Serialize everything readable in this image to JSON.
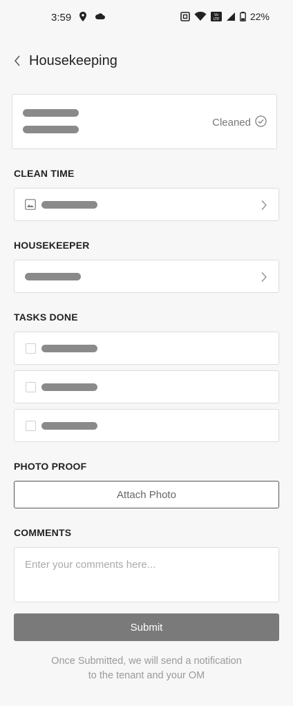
{
  "status_bar": {
    "time": "3:59",
    "battery": "22%",
    "volte": "Vo LTE"
  },
  "header": {
    "title": "Housekeeping"
  },
  "summary_card": {
    "status": "Cleaned"
  },
  "sections": {
    "clean_time": "CLEAN TIME",
    "housekeeper": "HOUSEKEEPER",
    "tasks_done": "TASKS DONE",
    "photo_proof": "PHOTO PROOF",
    "comments": "COMMENTS"
  },
  "actions": {
    "attach_photo": "Attach Photo",
    "submit": "Submit"
  },
  "comments": {
    "placeholder": "Enter your comments here..."
  },
  "footnote": {
    "line1": "Once Submitted, we will send a notification",
    "line2": "to the tenant and your OM"
  },
  "tasks": [
    {
      "checked": false
    },
    {
      "checked": false
    },
    {
      "checked": false
    }
  ],
  "colors": {
    "background": "#f7f7f7",
    "skeleton": "#8a8a8a",
    "submit_bg": "#7a7a7a"
  }
}
